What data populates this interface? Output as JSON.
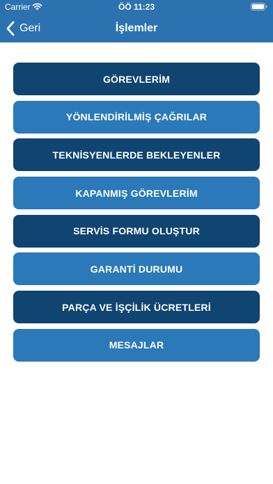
{
  "status_bar": {
    "carrier": "Carrier",
    "time": "ÖÖ 11:23"
  },
  "nav": {
    "back_label": "Geri",
    "title": "İşlemler"
  },
  "colors": {
    "header": "#2c72b0",
    "button_dark": "#0f4570",
    "button_light": "#2b79b8"
  },
  "menu": {
    "items": [
      {
        "label": "GÖREVLERİM"
      },
      {
        "label": "YÖNLENDİRİLMİŞ ÇAĞRILAR"
      },
      {
        "label": "TEKNİSYENLERDE BEKLEYENLER"
      },
      {
        "label": "KAPANMIŞ GÖREVLERİM"
      },
      {
        "label": "SERVİS FORMU OLUŞTUR"
      },
      {
        "label": "GARANTİ DURUMU"
      },
      {
        "label": "PARÇA VE İŞÇİLİK ÜCRETLERİ"
      },
      {
        "label": "MESAJLAR"
      }
    ]
  }
}
